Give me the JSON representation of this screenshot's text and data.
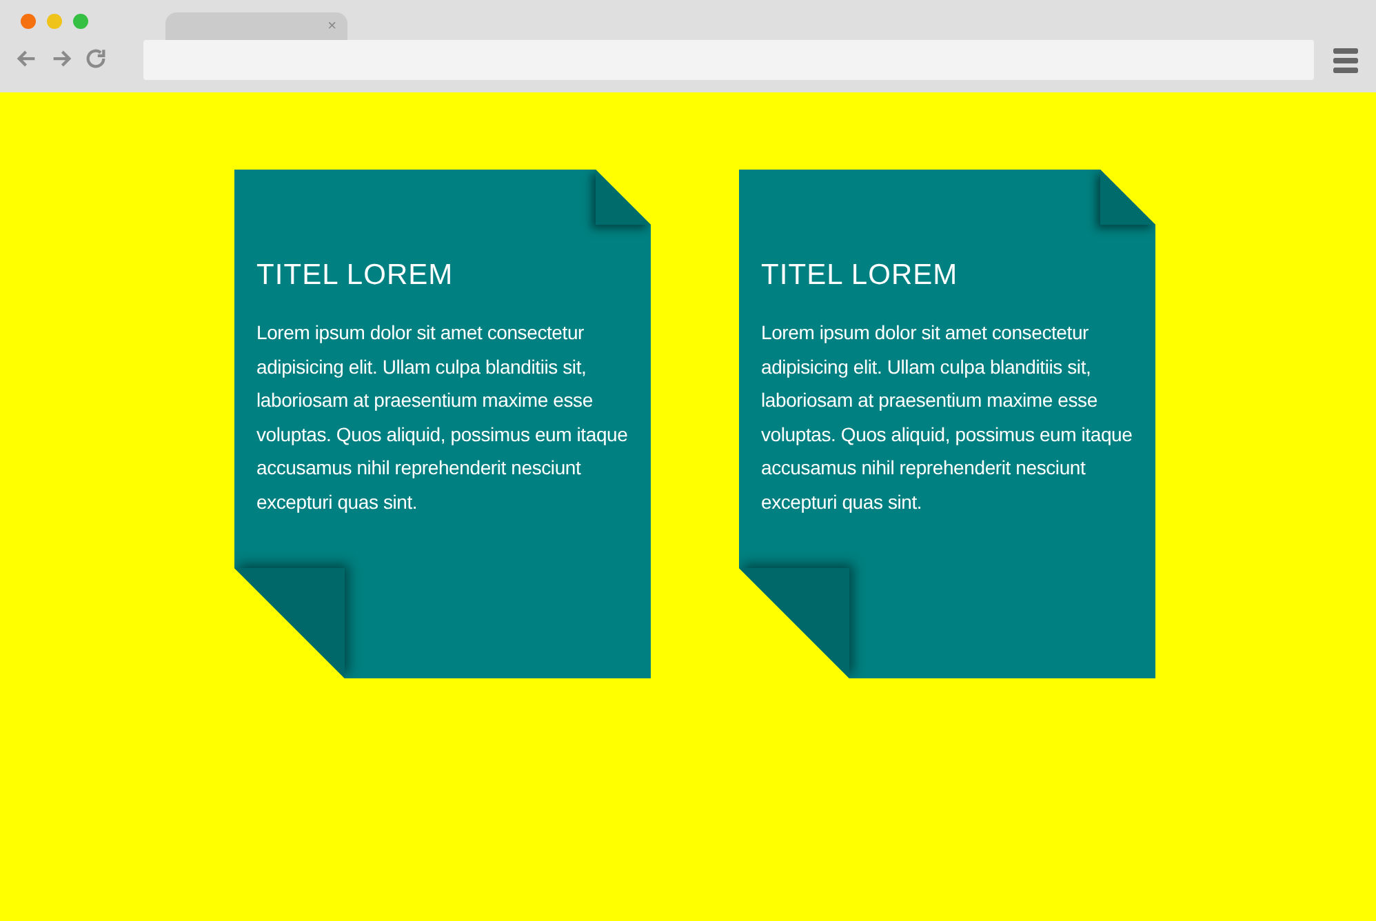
{
  "browser": {
    "tab": {
      "close": "×"
    }
  },
  "cards": [
    {
      "title": "TITEL LOREM",
      "text": "Lorem ipsum dolor sit amet consectetur adipisicing elit. Ullam culpa blanditiis sit, laboriosam at praesentium maxime esse voluptas. Quos aliquid, possimus eum itaque accusamus nihil reprehenderit nesciunt excepturi quas sint."
    },
    {
      "title": "TITEL LOREM",
      "text": "Lorem ipsum dolor sit amet consectetur adipisicing elit. Ullam culpa blanditiis sit, laboriosam at praesentium maxime esse voluptas. Quos aliquid, possimus eum itaque accusamus nihil reprehenderit nesciunt excepturi quas sint."
    }
  ]
}
